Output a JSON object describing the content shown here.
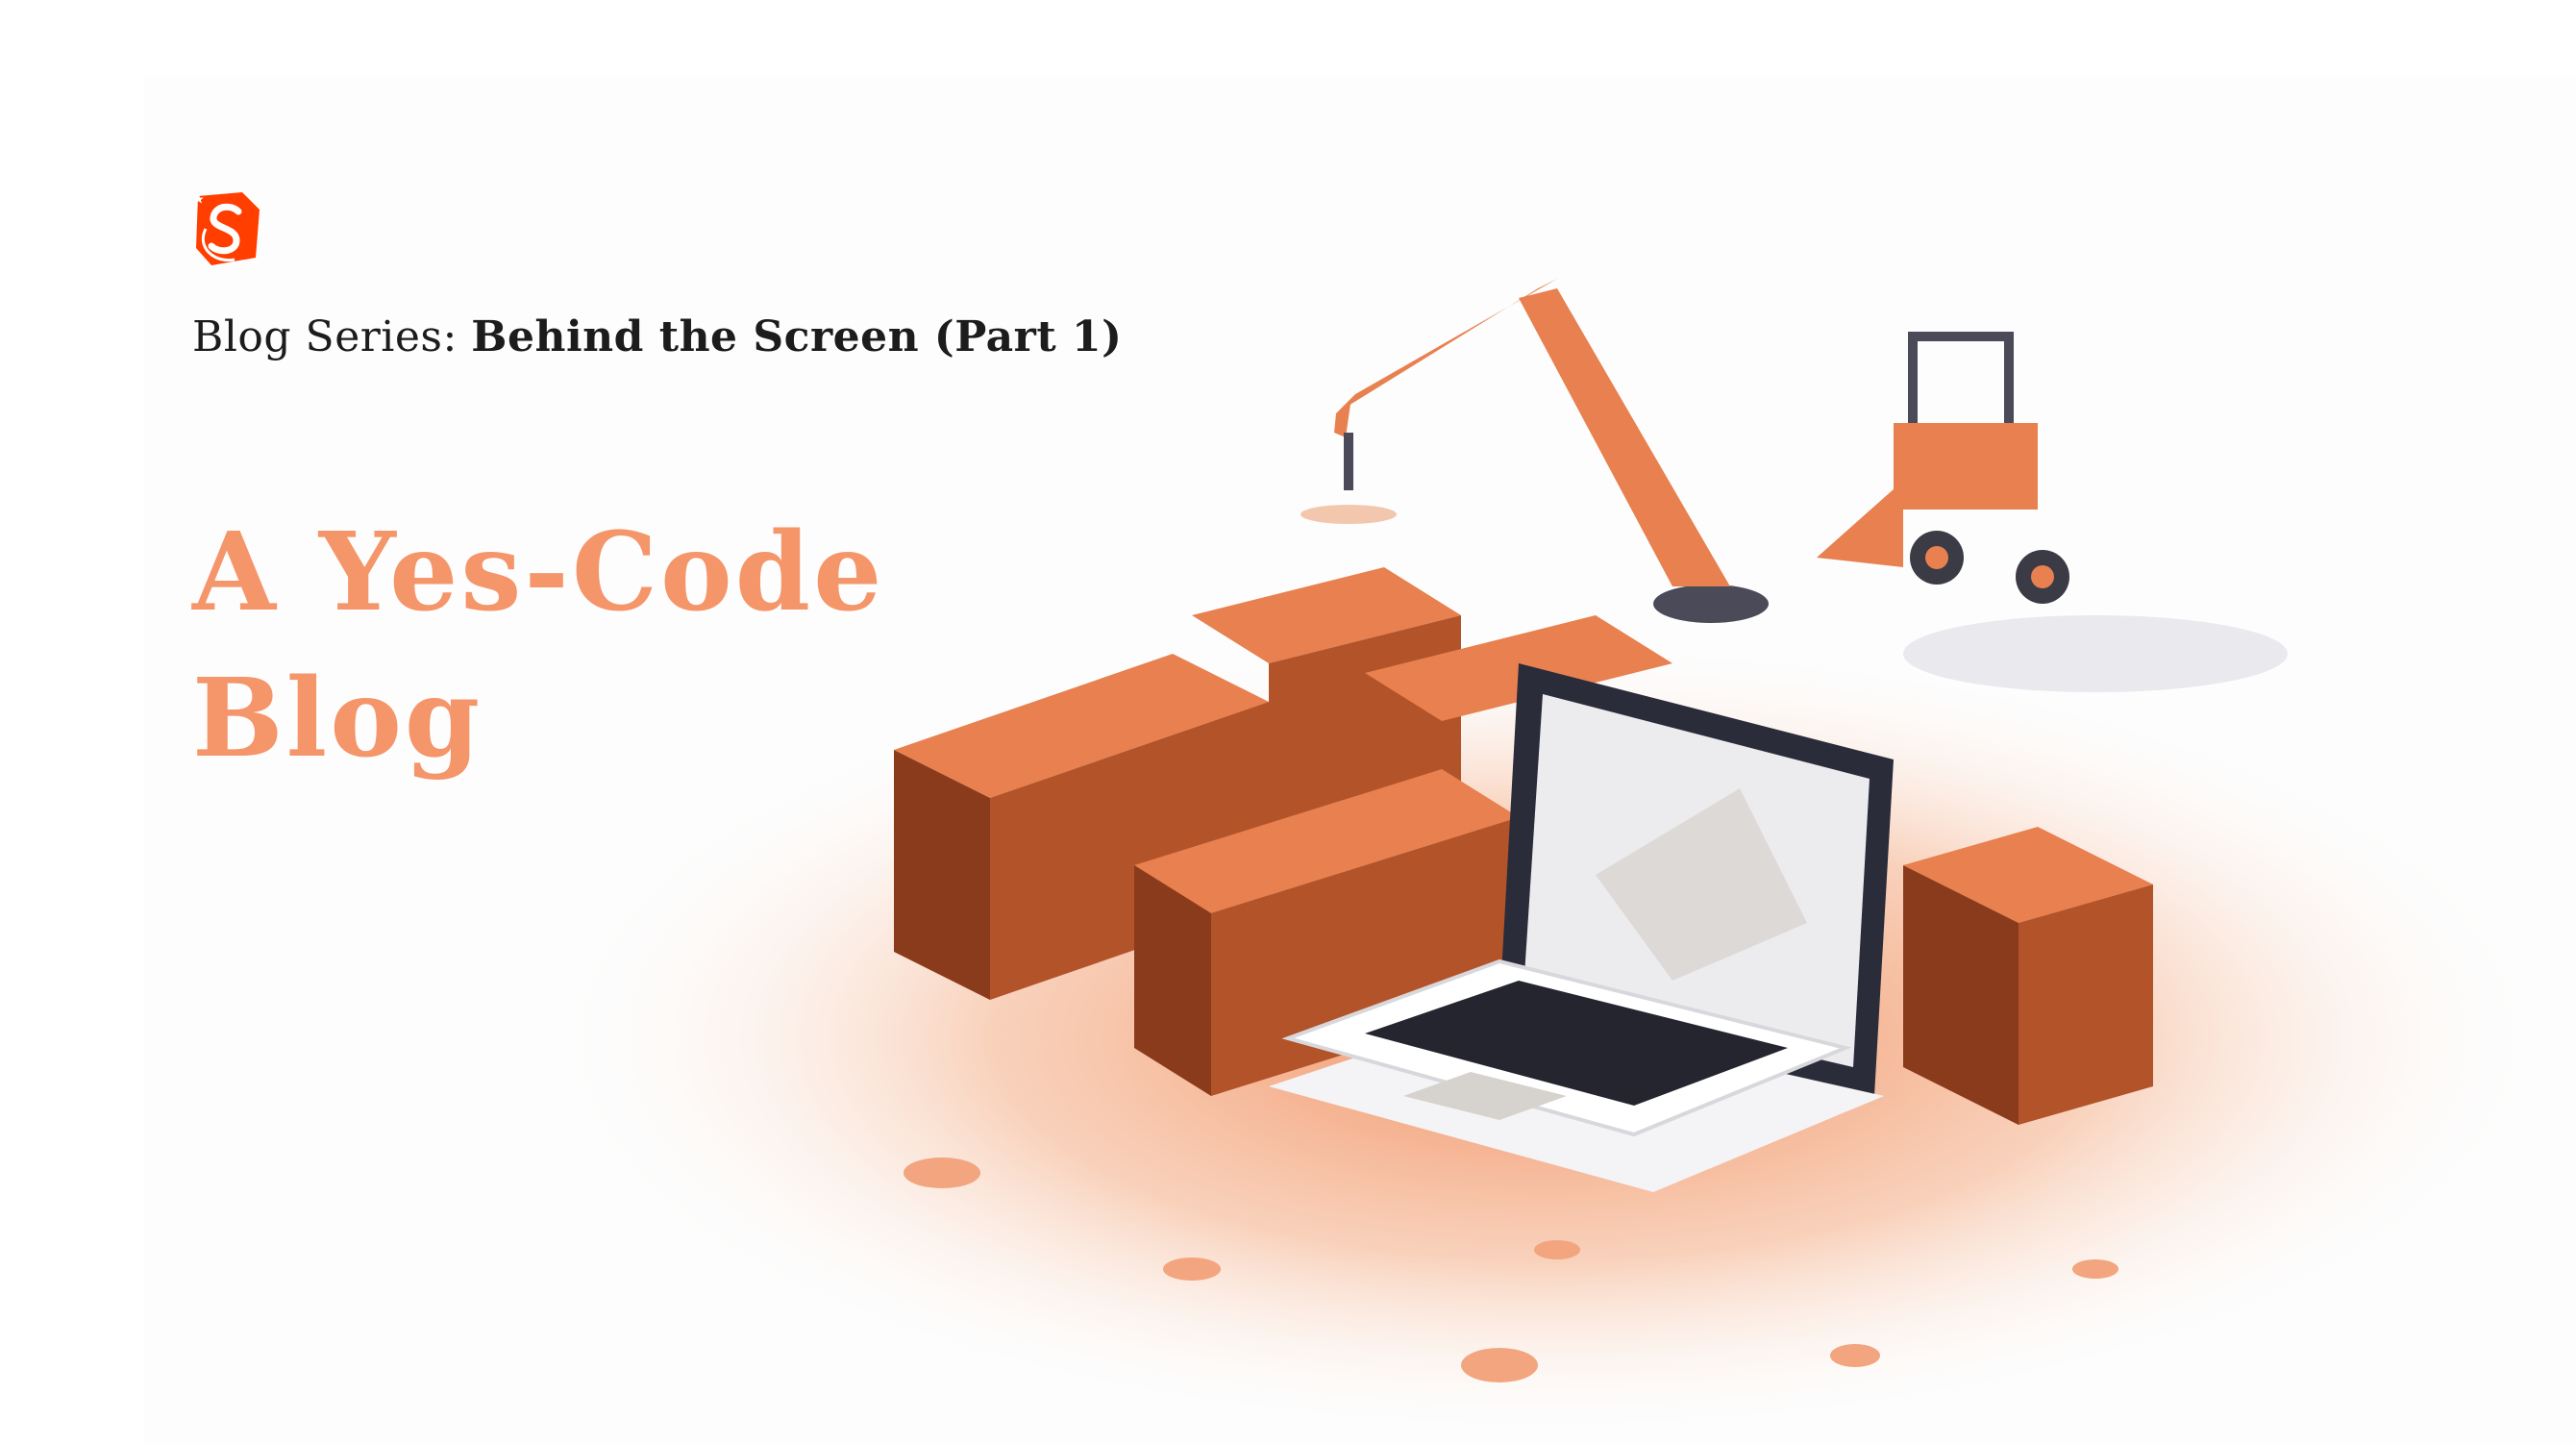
{
  "brand": {
    "logo_icon": "svelte-style-s-logo-icon",
    "accent_color": "#ff3e00"
  },
  "header": {
    "series_prefix": "Blog Series:",
    "series_name": "Behind the Screen (Part 1)"
  },
  "hero": {
    "title_line1": "A Yes-Code",
    "title_line2": "Blog",
    "title_color": "#f5956a"
  },
  "illustration": {
    "subject": "construction-site-with-laptop-illustration",
    "primary_color": "#e8804f",
    "dark_color": "#7a3318"
  }
}
